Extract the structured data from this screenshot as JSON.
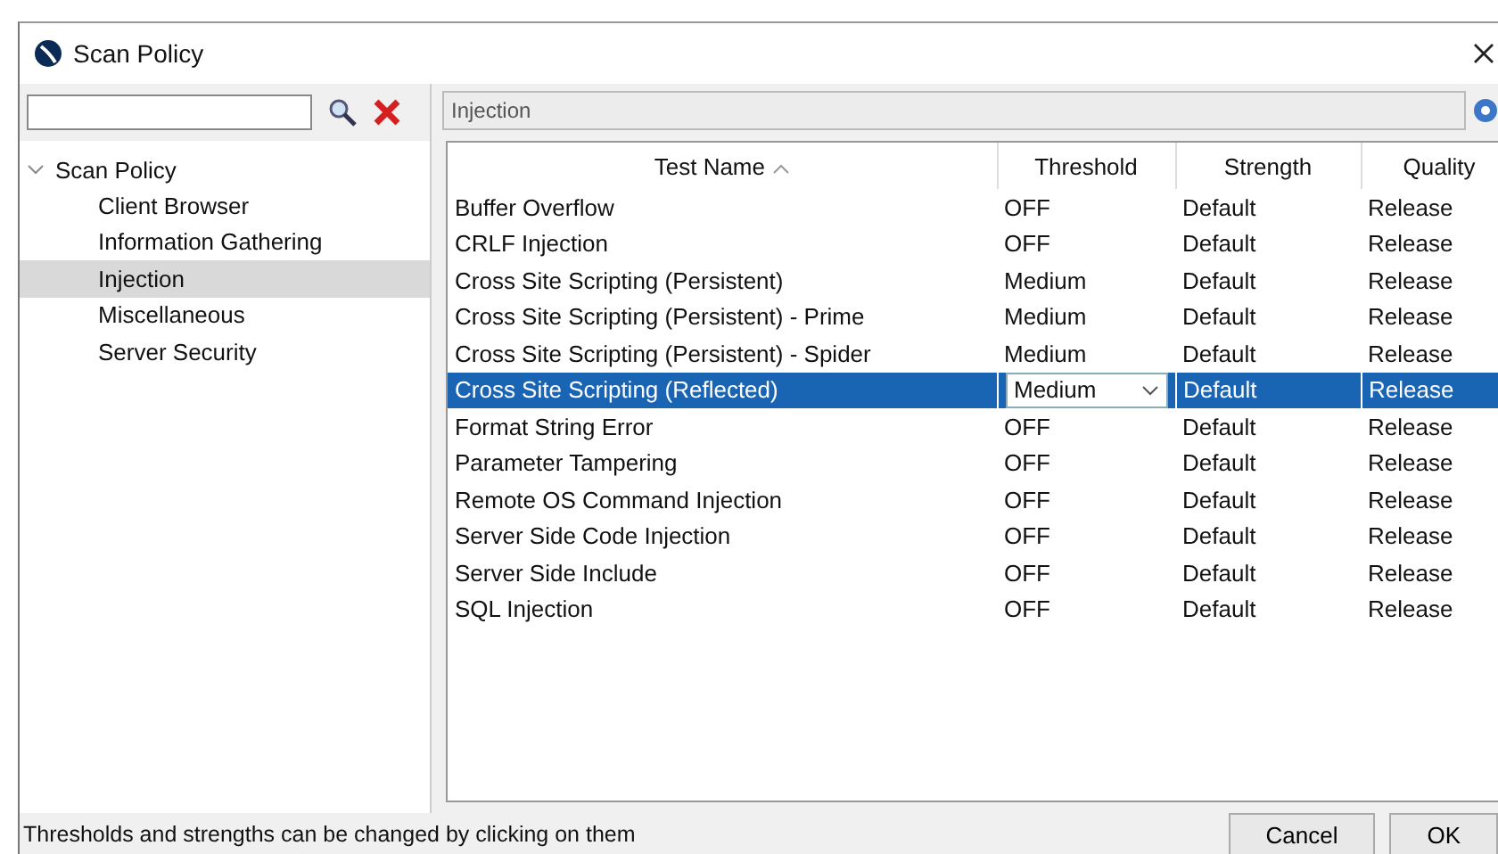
{
  "window": {
    "title": "Scan Policy"
  },
  "tree": {
    "root": {
      "label": "Scan Policy",
      "expanded": true,
      "children": [
        {
          "label": "Client Browser",
          "selected": false
        },
        {
          "label": "Information Gathering",
          "selected": false
        },
        {
          "label": "Injection",
          "selected": true
        },
        {
          "label": "Miscellaneous",
          "selected": false
        },
        {
          "label": "Server Security",
          "selected": false
        }
      ]
    }
  },
  "panel": {
    "title": "Injection"
  },
  "table": {
    "columns": [
      {
        "label": "Test Name",
        "sorted": true
      },
      {
        "label": "Threshold",
        "sorted": false
      },
      {
        "label": "Strength",
        "sorted": false
      },
      {
        "label": "Quality",
        "sorted": false
      }
    ],
    "rows": [
      {
        "cells": [
          "Buffer Overflow",
          "OFF",
          "Default",
          "Release"
        ],
        "selected": false
      },
      {
        "cells": [
          "CRLF Injection",
          "OFF",
          "Default",
          "Release"
        ],
        "selected": false
      },
      {
        "cells": [
          "Cross Site Scripting (Persistent)",
          "Medium",
          "Default",
          "Release"
        ],
        "selected": false
      },
      {
        "cells": [
          "Cross Site Scripting (Persistent) - Prime",
          "Medium",
          "Default",
          "Release"
        ],
        "selected": false
      },
      {
        "cells": [
          "Cross Site Scripting (Persistent) - Spider",
          "Medium",
          "Default",
          "Release"
        ],
        "selected": false
      },
      {
        "cells": [
          "Cross Site Scripting (Reflected)",
          "Medium",
          "Default",
          "Release"
        ],
        "selected": true
      },
      {
        "cells": [
          "Format String Error",
          "OFF",
          "Default",
          "Release"
        ],
        "selected": false
      },
      {
        "cells": [
          "Parameter Tampering",
          "OFF",
          "Default",
          "Release"
        ],
        "selected": false
      },
      {
        "cells": [
          "Remote OS Command Injection",
          "OFF",
          "Default",
          "Release"
        ],
        "selected": false
      },
      {
        "cells": [
          "Server Side Code Injection",
          "OFF",
          "Default",
          "Release"
        ],
        "selected": false
      },
      {
        "cells": [
          "Server Side Include",
          "OFF",
          "Default",
          "Release"
        ],
        "selected": false
      },
      {
        "cells": [
          "SQL Injection",
          "OFF",
          "Default",
          "Release"
        ],
        "selected": false
      }
    ]
  },
  "status_bar": {
    "text": "Thresholds and strengths can be changed by clicking on them"
  },
  "buttons": [
    "Cancel",
    "OK"
  ]
}
